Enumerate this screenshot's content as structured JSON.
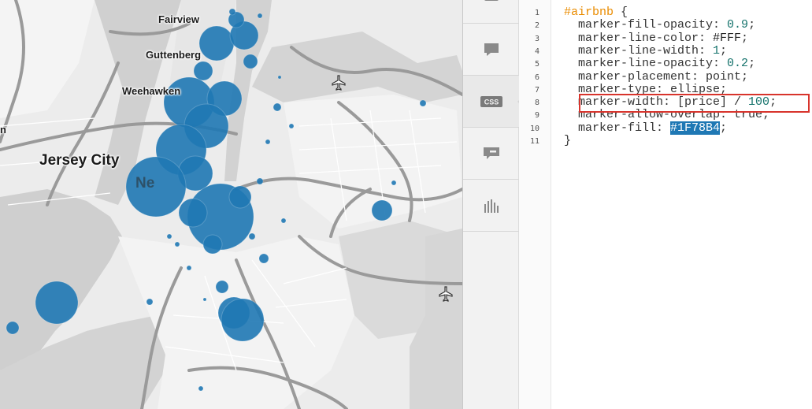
{
  "map": {
    "labels": {
      "fairview": "Fairview",
      "guttenberg": "Guttenberg",
      "weehawken": "Weehawken",
      "jersey_city": "Jersey City",
      "ny_partial": "Ne",
      "n_partial": "n"
    },
    "marker_color": "#1F78B4"
  },
  "toolbar": {
    "items": [
      {
        "name": "top-partial"
      },
      {
        "name": "infowindow",
        "icon": "speech-bubble-icon"
      },
      {
        "name": "css",
        "icon": "css-icon",
        "label": "CSS",
        "active": true
      },
      {
        "name": "legend",
        "icon": "legend-icon"
      },
      {
        "name": "chart",
        "icon": "bar-chart-icon"
      }
    ]
  },
  "editor": {
    "lines": [
      {
        "n": "1",
        "tokens": [
          {
            "t": "#airbnb",
            "c": "sel"
          },
          {
            "t": " {",
            "c": "prop"
          }
        ]
      },
      {
        "n": "2",
        "tokens": [
          {
            "t": "  marker-fill-opacity: ",
            "c": "prop"
          },
          {
            "t": "0.9",
            "c": "num"
          },
          {
            "t": ";",
            "c": "prop"
          }
        ]
      },
      {
        "n": "3",
        "tokens": [
          {
            "t": "  marker-line-color: ",
            "c": "prop"
          },
          {
            "t": "#FFF",
            "c": "hex"
          },
          {
            "t": ";",
            "c": "prop"
          }
        ]
      },
      {
        "n": "4",
        "tokens": [
          {
            "t": "  marker-line-width: ",
            "c": "prop"
          },
          {
            "t": "1",
            "c": "num"
          },
          {
            "t": ";",
            "c": "prop"
          }
        ]
      },
      {
        "n": "5",
        "tokens": [
          {
            "t": "  marker-line-opacity: ",
            "c": "prop"
          },
          {
            "t": "0.2",
            "c": "num"
          },
          {
            "t": ";",
            "c": "prop"
          }
        ]
      },
      {
        "n": "6",
        "tokens": [
          {
            "t": "  marker-placement: point;",
            "c": "prop"
          }
        ]
      },
      {
        "n": "7",
        "tokens": [
          {
            "t": "  marker-type: ellipse;",
            "c": "prop"
          }
        ]
      },
      {
        "n": "8",
        "tokens": [
          {
            "t": "  marker-width: [price] / ",
            "c": "prop"
          },
          {
            "t": "100",
            "c": "num"
          },
          {
            "t": ";",
            "c": "prop"
          }
        ]
      },
      {
        "n": "9",
        "tokens": [
          {
            "t": "  marker-allow-overlap: true;",
            "c": "prop"
          }
        ]
      },
      {
        "n": "10",
        "tokens": [
          {
            "t": "  marker-fill: ",
            "c": "prop"
          },
          {
            "t": "#1F78B4",
            "c": "hex-hl"
          },
          {
            "t": ";",
            "c": "prop"
          }
        ]
      },
      {
        "n": "11",
        "tokens": [
          {
            "t": "}",
            "c": "prop"
          }
        ]
      }
    ],
    "highlight_color": "#D8342C"
  }
}
